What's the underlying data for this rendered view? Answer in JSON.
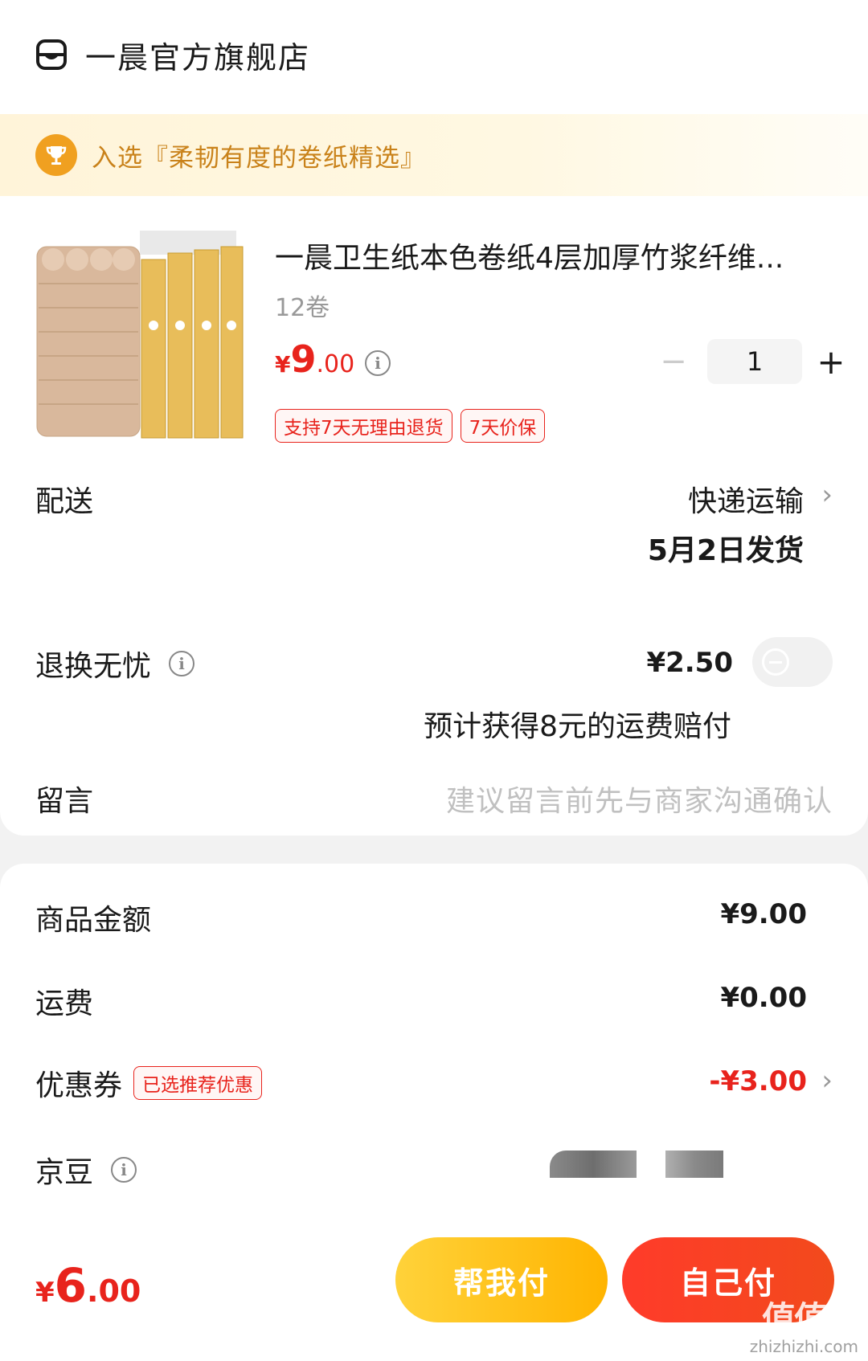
{
  "store": {
    "name": "一晨官方旗舰店"
  },
  "banner": {
    "text": "入选『柔韧有度的卷纸精选』"
  },
  "product": {
    "title": "一晨卫生纸本色卷纸4层加厚竹浆纤维...",
    "spec": "12卷",
    "price": {
      "symbol": "¥",
      "integer": "9",
      "decimal": ".00"
    },
    "quantity": "1",
    "tags": [
      "支持7天无理由退货",
      "7天价保"
    ]
  },
  "delivery": {
    "label": "配送",
    "method": "快递运输",
    "date": "5月2日发货"
  },
  "insurance": {
    "label": "退换无忧",
    "price": "¥2.50",
    "note": "预计获得8元的运费赔付",
    "enabled": false
  },
  "message": {
    "label": "留言",
    "placeholder": "建议留言前先与商家沟通确认"
  },
  "summary": {
    "goods_label": "商品金额",
    "goods_value": "¥9.00",
    "shipping_label": "运费",
    "shipping_value": "¥0.00",
    "coupon_label": "优惠券",
    "coupon_tag": "已选推荐优惠",
    "coupon_value": "-¥3.00",
    "beans_label": "京豆"
  },
  "checkout": {
    "total": {
      "symbol": "¥",
      "integer": "6",
      "decimal": ".00"
    },
    "help_pay": "帮我付",
    "self_pay": "自己付"
  },
  "watermark": {
    "text": "值值值",
    "sub": "zhizhizhi.com"
  },
  "colors": {
    "accent": "#e8231c",
    "gold": "#c9821a",
    "yellow_btn": "#ffc21a"
  }
}
